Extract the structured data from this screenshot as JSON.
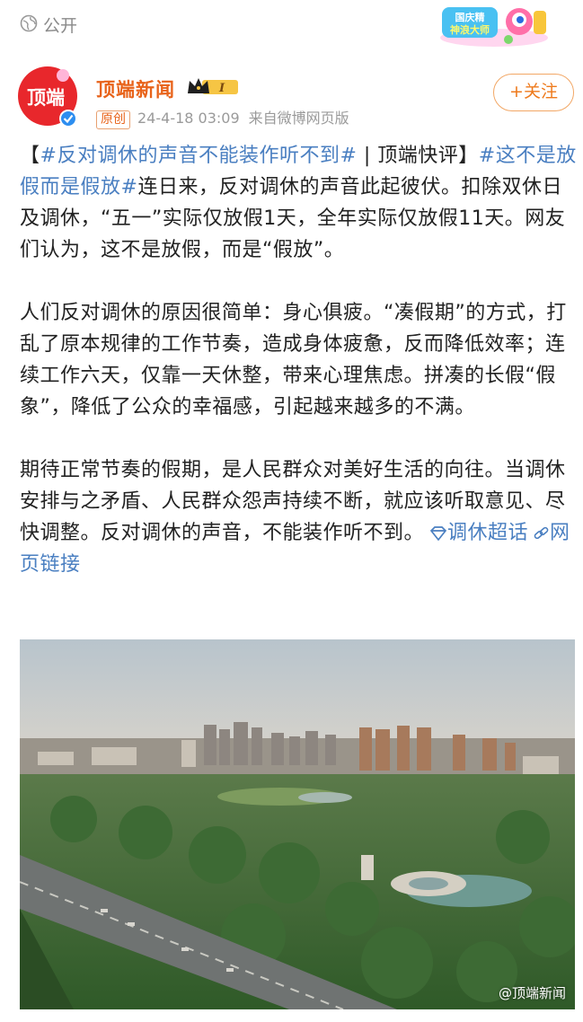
{
  "topbar": {
    "visibility_icon": "globe-icon",
    "visibility": "公开",
    "promo_text": "国庆精神浪大师"
  },
  "post_header": {
    "avatar_text": "顶端",
    "avatar_icon": "verified-icon",
    "user_name": "顶端新闻",
    "vip_level": "I",
    "original_tag": "原创",
    "time": "24-4-18 03:09",
    "source": "来自微博网页版",
    "follow_label": "+关注"
  },
  "post": {
    "p1_bracket_open": "【",
    "p1_topic1": "#反对调休的声音不能装作听不到#",
    "p1_mid": " | 顶端快评】",
    "p1_topic2": "#这不是放假而是假放#",
    "p1_text": "连日来，反对调休的声音此起彼伏。扣除双休日及调休，“五一”实际仅放假1天，全年实际仅放假11天。网友们认为，这不是放假，而是“假放”。",
    "p2_text": "人们反对调休的原因很简单：身心俱疲。“凑假期”的方式，打乱了原本规律的工作节奏，造成身体疲惫，反而降低效率；连续工作六天，仅靠一天休整，带来心理焦虑。拼凑的长假“假象”，降低了公众的幸福感，引起越来越多的不满。",
    "p3_text": "期待正常节奏的假期，是人民群众对美好生活的向往。当调休安排与之矛盾、人民群众怨声持续不断，就应该听取意见、尽快调整。反对调休的声音，不能装作听不到。",
    "supertopic_label": "调休超话",
    "weblink_label": "网页链接"
  },
  "image": {
    "watermark": "@顶端新闻"
  },
  "colors": {
    "accent_orange": "#e8631a",
    "link_blue": "#4a7fc1"
  }
}
